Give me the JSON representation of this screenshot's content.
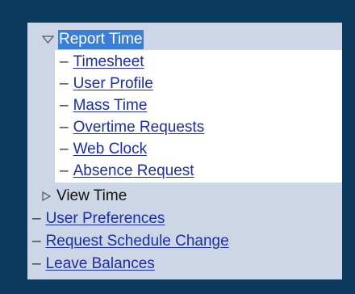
{
  "menu": {
    "report_time": {
      "label": "Report Time",
      "expanded": true,
      "items": [
        {
          "label": "Timesheet"
        },
        {
          "label": "User Profile"
        },
        {
          "label": "Mass Time"
        },
        {
          "label": "Overtime Requests"
        },
        {
          "label": "Web Clock"
        },
        {
          "label": "Absence Request"
        }
      ]
    },
    "view_time": {
      "label": "View Time",
      "expanded": false
    },
    "root_items": [
      {
        "label": "User Preferences"
      },
      {
        "label": "Request Schedule Change"
      },
      {
        "label": "Leave Balances"
      }
    ]
  },
  "colors": {
    "frame_bg": "#0c3a5e",
    "panel_bg": "#cdd6e6",
    "submenu_bg": "#ffffff",
    "selected_bg": "#3a7fd6",
    "link": "#1c2f9c"
  }
}
